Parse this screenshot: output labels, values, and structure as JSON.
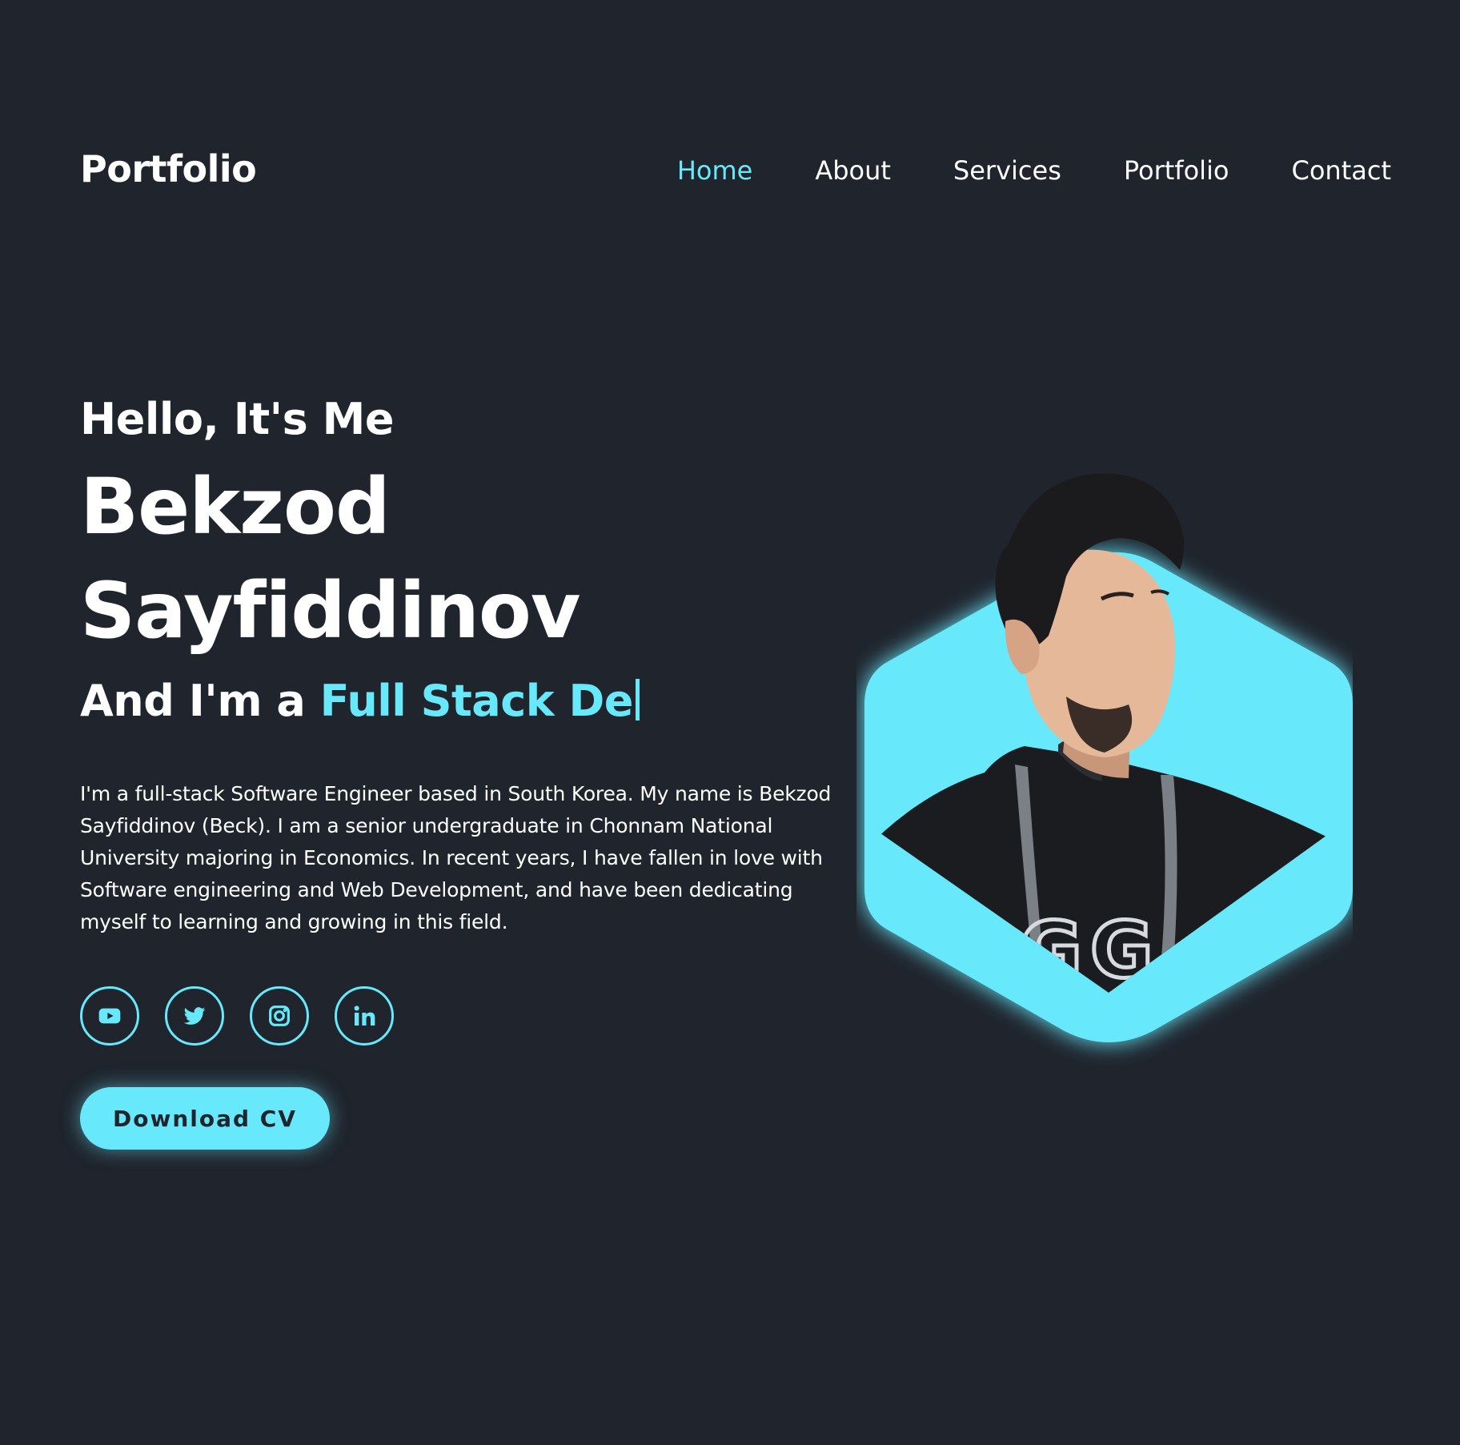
{
  "header": {
    "logo": "Portfolio",
    "nav": [
      {
        "label": "Home",
        "active": true
      },
      {
        "label": "About",
        "active": false
      },
      {
        "label": "Services",
        "active": false
      },
      {
        "label": "Portfolio",
        "active": false
      },
      {
        "label": "Contact",
        "active": false
      }
    ]
  },
  "hero": {
    "greeting": "Hello, It's Me",
    "name_line1": "Bekzod",
    "name_line2": "Sayfiddinov",
    "role_prefix": "And I'm a",
    "role_typed": "Full Stack De",
    "bio": "I'm a full-stack Software Engineer based in South Korea. My name is Bekzod Sayfiddinov (Beck). I am a senior undergraduate in Chonnam National University majoring in Economics. In recent years, I have fallen in love with Software engineering and Web Development, and have been dedicating myself to learning and growing in this field.",
    "social": [
      {
        "icon": "youtube-icon"
      },
      {
        "icon": "twitter-icon"
      },
      {
        "icon": "instagram-icon"
      },
      {
        "icon": "linkedin-icon"
      }
    ],
    "cta_label": "Download CV",
    "portrait_text": "GG"
  },
  "colors": {
    "background": "#1f242d",
    "accent": "#67e9fb",
    "text": "#ffffff"
  }
}
